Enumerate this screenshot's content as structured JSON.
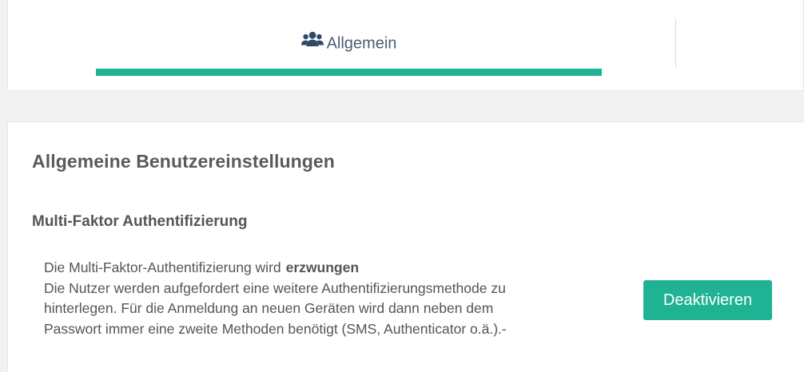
{
  "tabs": {
    "items": [
      {
        "label": "Allgemein",
        "icon": "users-icon",
        "active": true
      }
    ],
    "active_color": "#1fb393"
  },
  "panel": {
    "title": "Allgemeine Benutzereinstellungen",
    "section": {
      "title": "Multi-Faktor Authentifizierung",
      "status_prefix": "Die Multi-Faktor-Authentifizierung wird",
      "status_value": "erzwungen",
      "description_lines": [
        "Die Nutzer werden aufgefordert eine weitere Authentifizierungsmethode zu",
        "hinterlegen. Für die Anmeldung an neuen Geräten wird dann neben dem",
        "Passwort immer eine zweite Methoden benötigt (SMS, Authenticator o.ä.).-"
      ],
      "button_label": "Deaktivieren",
      "button_color": "#1fb393"
    }
  }
}
